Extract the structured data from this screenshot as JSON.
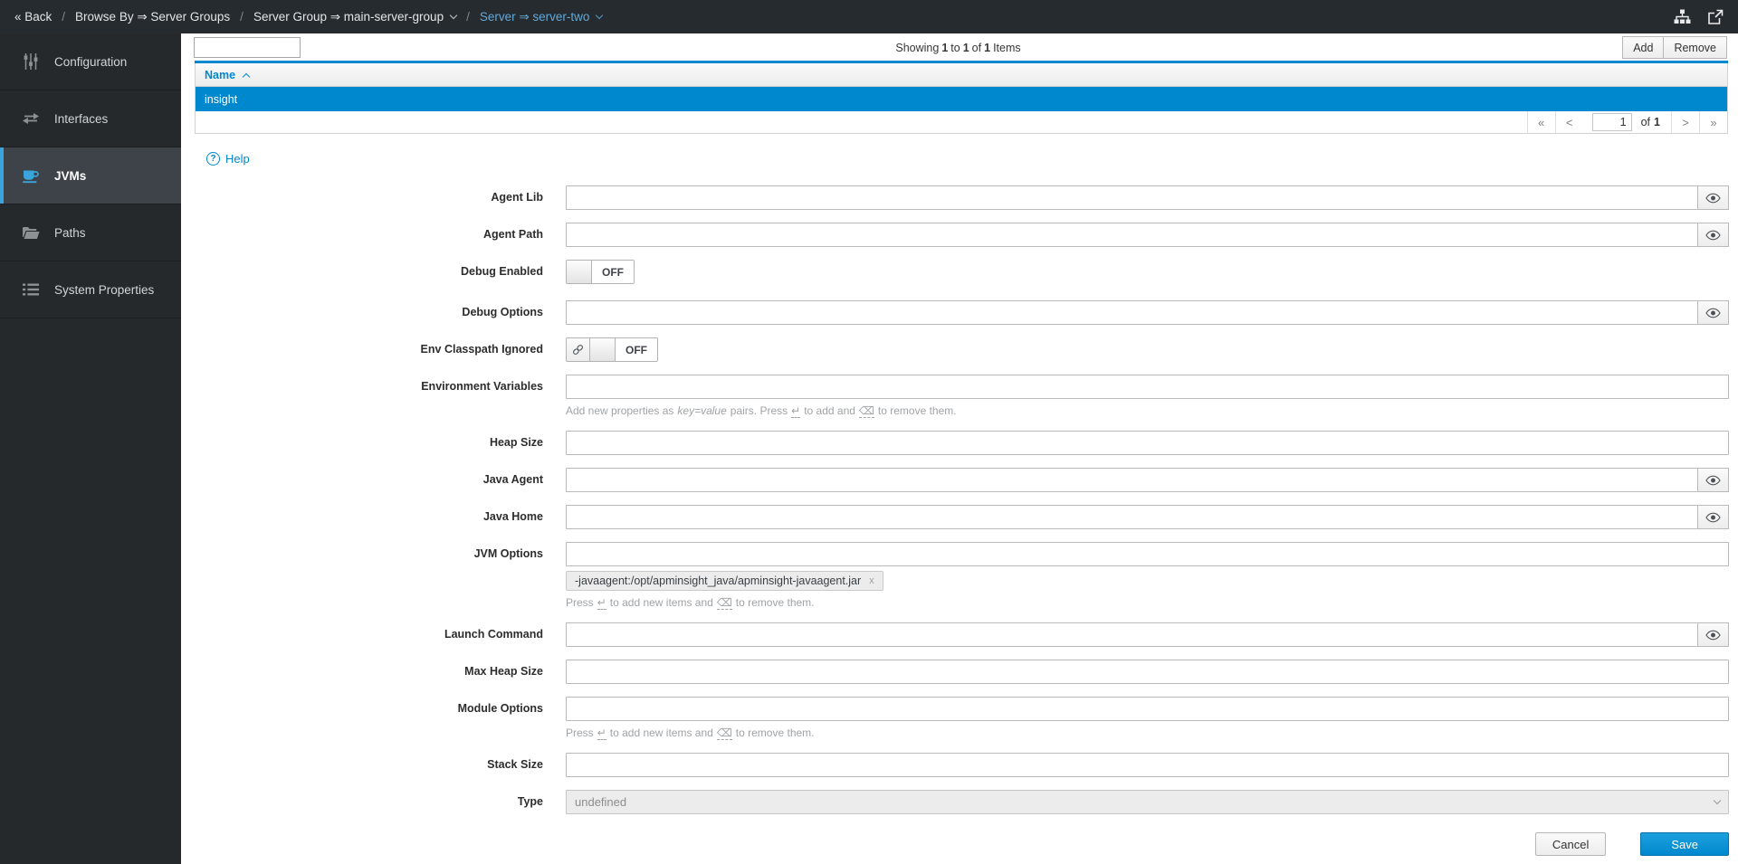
{
  "topnav": {
    "back_label": "« Back",
    "sep": "/",
    "crumbs": [
      {
        "label": "Browse By ⇒ Server Groups"
      },
      {
        "label": "Server Group ⇒ main-server-group"
      },
      {
        "label": "Server ⇒ server-two"
      }
    ]
  },
  "sidebar": {
    "items": [
      {
        "label": "Configuration"
      },
      {
        "label": "Interfaces"
      },
      {
        "label": "JVMs"
      },
      {
        "label": "Paths"
      },
      {
        "label": "System Properties"
      }
    ]
  },
  "toolbar": {
    "search_value": "",
    "showing": {
      "t1": "Showing",
      "n1": "1",
      "t2": "to",
      "n2": "1",
      "t3": "of",
      "n3": "1",
      "t4": "Items"
    },
    "add_label": "Add",
    "remove_label": "Remove"
  },
  "table": {
    "name_column": "Name",
    "rows": [
      {
        "name": "insight"
      }
    ],
    "pager": {
      "first": "«",
      "prev": "<",
      "page": "1",
      "of": "of",
      "total": "1",
      "next": ">",
      "last": "»"
    }
  },
  "form": {
    "help_label": "Help",
    "help_icon": "?",
    "fields": [
      {
        "label": "Agent Lib",
        "kind": "text-eye",
        "value": ""
      },
      {
        "label": "Agent Path",
        "kind": "text-eye",
        "value": ""
      },
      {
        "label": "Debug Enabled",
        "kind": "toggle",
        "state": "OFF"
      },
      {
        "label": "Debug Options",
        "kind": "text-eye",
        "value": ""
      },
      {
        "label": "Env Classpath Ignored",
        "kind": "toggle-link",
        "state": "OFF"
      },
      {
        "label": "Environment Variables",
        "kind": "text",
        "value": "",
        "helper": {
          "t1": "Add new properties as",
          "em": "key=value",
          "t2": "pairs. Press",
          "enter": "↵",
          "t3": "to add and",
          "backspace": "⌫",
          "t4": "to remove them."
        }
      },
      {
        "label": "Heap Size",
        "kind": "text",
        "value": ""
      },
      {
        "label": "Java Agent",
        "kind": "text-eye",
        "value": ""
      },
      {
        "label": "Java Home",
        "kind": "text-eye",
        "value": ""
      },
      {
        "label": "JVM Options",
        "kind": "text",
        "value": "",
        "tag": {
          "text": "-javaagent:/opt/apminsight_java/apminsight-javaagent.jar",
          "remove": "x"
        },
        "helper": {
          "t1": "Press",
          "enter": "↵",
          "t2": "to add new items and",
          "backspace": "⌫",
          "t3": "to remove them."
        }
      },
      {
        "label": "Launch Command",
        "kind": "text-eye",
        "value": ""
      },
      {
        "label": "Max Heap Size",
        "kind": "text",
        "value": ""
      },
      {
        "label": "Module Options",
        "kind": "text",
        "value": "",
        "helper": {
          "t1": "Press",
          "enter": "↵",
          "t2": "to add new items and",
          "backspace": "⌫",
          "t3": "to remove them."
        }
      },
      {
        "label": "Stack Size",
        "kind": "text",
        "value": ""
      },
      {
        "label": "Type",
        "kind": "select",
        "value": "undefined"
      }
    ]
  },
  "footer": {
    "cancel_label": "Cancel",
    "save_label": "Save"
  }
}
